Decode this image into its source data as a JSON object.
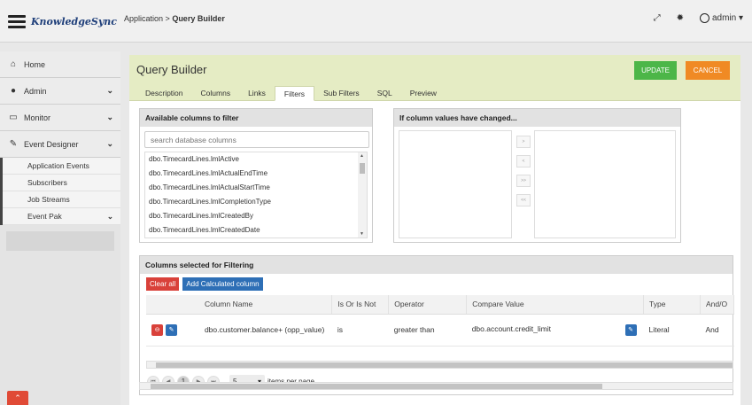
{
  "app": {
    "logo": "KnowledgeSync"
  },
  "breadcrumb": {
    "parent": "Application >",
    "current": "Query Builder"
  },
  "topbar": {
    "user": "admin ▾"
  },
  "sidebar": {
    "items": [
      {
        "label": "Home",
        "icon": "home-icon"
      },
      {
        "label": "Admin",
        "icon": "user-icon"
      },
      {
        "label": "Monitor",
        "icon": "monitor-icon"
      },
      {
        "label": "Event Designer",
        "icon": "edit-icon"
      }
    ],
    "sub_items": [
      "Application Events",
      "Subscribers",
      "Job Streams",
      "Event Pak"
    ]
  },
  "header": {
    "title": "Query Builder",
    "update_label": "UPDATE",
    "cancel_label": "CANCEL",
    "tabs": [
      "Description",
      "Columns",
      "Links",
      "Filters",
      "Sub Filters",
      "SQL",
      "Preview"
    ],
    "active_tab": "Filters"
  },
  "available": {
    "title": "Available columns to filter",
    "search_placeholder": "search database columns",
    "columns": [
      "dbo.TimecardLines.lmlActive",
      "dbo.TimecardLines.lmlActualEndTime",
      "dbo.TimecardLines.lmlActualStartTime",
      "dbo.TimecardLines.lmlCompletionType",
      "dbo.TimecardLines.lmlCreatedBy",
      "dbo.TimecardLines.lmlCreatedDate"
    ]
  },
  "changed": {
    "title": "If column values have changed...",
    "move_buttons": [
      ">",
      "<",
      ">>",
      "<<"
    ]
  },
  "selected": {
    "title": "Columns selected for Filtering",
    "clear_label": "Clear all",
    "calc_label": "Add Calculated column",
    "headers": [
      "Column Name",
      "Is Or Is Not",
      "Operator",
      "Compare Value",
      "Type",
      "And/O"
    ],
    "rows": [
      {
        "column_name": "dbo.customer.balance+ (opp_value)",
        "is_or_is_not": "is",
        "operator": "greater than",
        "compare_value": "dbo.account.credit_limit",
        "type": "Literal",
        "and_or": "And"
      }
    ],
    "pager": {
      "current_page": "1",
      "page_size": "5",
      "items_label": "items per page"
    }
  },
  "colors": {
    "update": "#4cb648",
    "cancel": "#f08a24",
    "header_bg": "#e5ecc4",
    "danger": "#d9413a",
    "primary": "#2e6fb6"
  }
}
